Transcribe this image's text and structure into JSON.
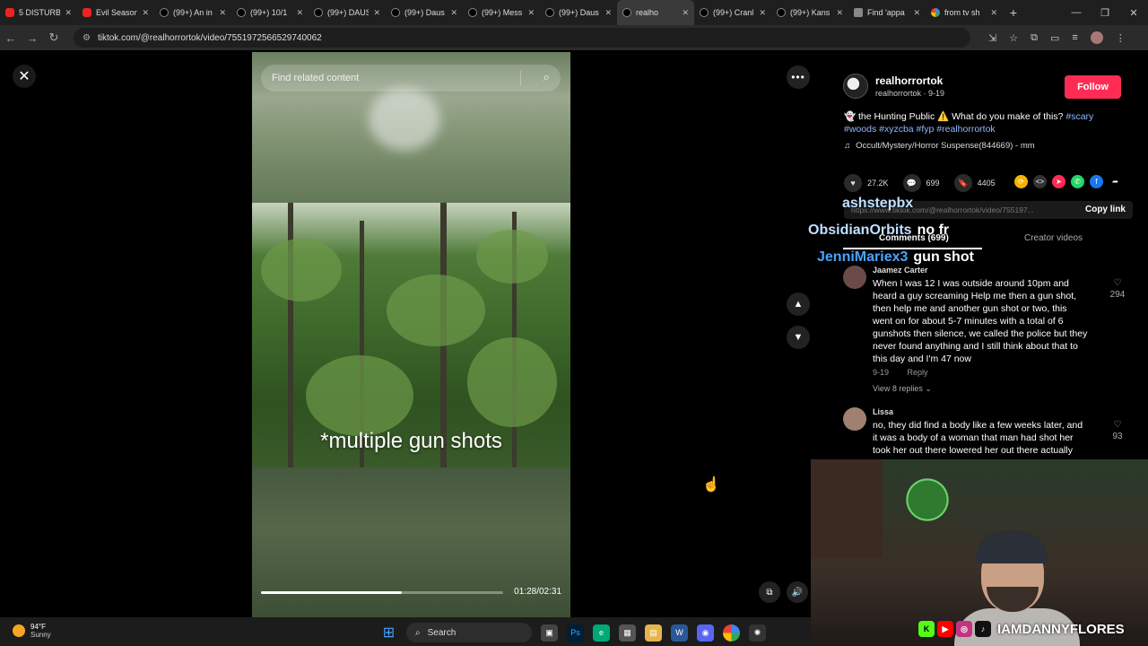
{
  "browser": {
    "tabs": [
      {
        "title": "5 DISTURB",
        "icon": "youtube-icon"
      },
      {
        "title": "Evil Season",
        "icon": "youtube-icon"
      },
      {
        "title": "(99+) An in",
        "icon": "tiktok-icon"
      },
      {
        "title": "(99+) 10/1",
        "icon": "tiktok-icon"
      },
      {
        "title": "(99+) DAUS",
        "icon": "tiktok-icon"
      },
      {
        "title": "(99+) Daus",
        "icon": "tiktok-icon"
      },
      {
        "title": "(99+) Mess",
        "icon": "tiktok-icon"
      },
      {
        "title": "(99+) Daus",
        "icon": "tiktok-icon"
      },
      {
        "title": "realho",
        "icon": "tiktok-icon"
      },
      {
        "title": "(99+) Cranl",
        "icon": "tiktok-icon"
      },
      {
        "title": "(99+) Kans",
        "icon": "tiktok-icon"
      },
      {
        "title": "Find 'appa",
        "icon": "microsoft-icon"
      },
      {
        "title": "from tv sh",
        "icon": "google-icon"
      }
    ],
    "active_tab_index": 8,
    "url": "tiktok.com/@realhorrortok/video/7551972566529740062"
  },
  "video": {
    "search_placeholder": "Find related content",
    "caption": "*multiple gun shots",
    "time": "01:28/02:31",
    "progress": 0.58
  },
  "panel": {
    "author_handle": "realhorrortok",
    "author_sub": "realhorrortok · 9-19",
    "follow_label": "Follow",
    "desc_prefix": "👻 the Hunting Public ⚠️ What do you make of this?",
    "desc_tags": "#scary #woods #xyzcba #fyp #realhorrortok",
    "music": "Occult/Mystery/Horror Suspense(844669) - mm",
    "likes": "27.2K",
    "comments": "699",
    "saves": "4405",
    "link_text": "https://www.tiktok.com/@realhorrortok/video/755197...",
    "copy_link": "Copy link",
    "tab_comments": "Comments (699)",
    "tab_creator": "Creator videos",
    "comment1": {
      "name": "Jaamez Carter",
      "text": "When I was 12 I was outside around 10pm and heard a guy screaming Help me then a gun shot, then help me and another gun shot or two, this went on for about 5-7 minutes with a total of 6 gunshots then silence, we called the police but they never found anything and I still think about that to this day and I'm 47 now",
      "date": "9-19",
      "reply": "Reply",
      "likes": "294",
      "view_replies": "View 8 replies ⌄"
    },
    "comment2": {
      "name": "Lissa",
      "text": "no, they did find a body like a few weeks later, and it was a body of a woman that man had shot her took her out there lowered her out there actually",
      "likes": "93"
    }
  },
  "overlay_chat": [
    {
      "user": "ashstepbx",
      "msg": ""
    },
    {
      "user": "ObsidianOrbits",
      "msg": "no fr"
    },
    {
      "user": "JenniMariex3",
      "msg": "gun shot"
    }
  ],
  "webcam": {
    "handle": "IAMDANNYFLORES"
  },
  "taskbar": {
    "temp": "94°F",
    "condition": "Sunny",
    "search_label": "Search"
  },
  "colors": {
    "accent": "#fe2c55",
    "hashtag": "#8fb8ff"
  }
}
